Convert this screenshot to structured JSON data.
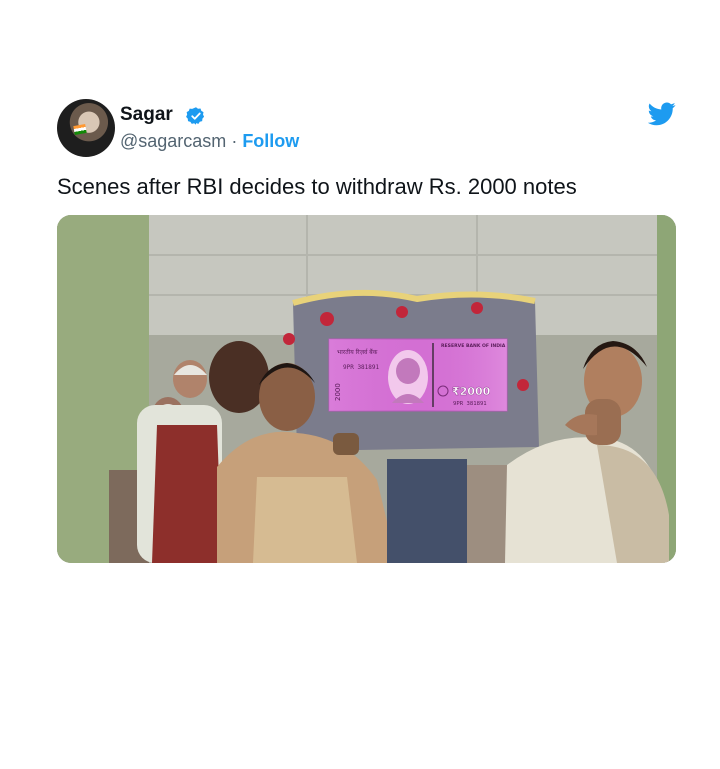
{
  "author": {
    "display_name": "Sagar",
    "handle": "@sagarcasm",
    "separator": " · ",
    "follow_label": "Follow"
  },
  "tweet": {
    "text": "Scenes after RBI decides to withdraw Rs. 2000 notes"
  },
  "media": {
    "banknote": {
      "hindi_label": "भारतीय रिज़र्व बैंक",
      "bank_label": "RESERVE BANK OF INDIA",
      "serial": "9PR 381891",
      "denomination": "₹2000",
      "vertical_value": "2000"
    }
  },
  "colors": {
    "accent": "#1d9bf0",
    "text": "#0f1419",
    "secondary_text": "#536471",
    "note_pink": "#d36fd3"
  },
  "icons": [
    "verified-badge-icon",
    "twitter-bird-icon"
  ]
}
